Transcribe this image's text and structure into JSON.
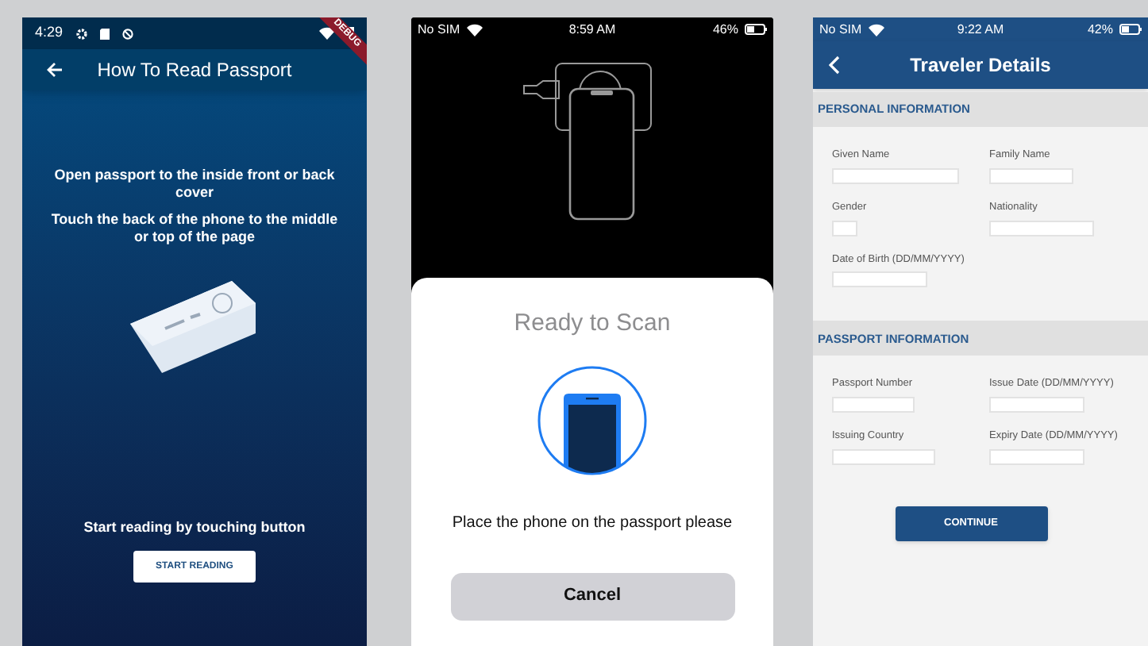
{
  "screens": [
    {
      "kind": "instructions",
      "status_bar": {
        "time": "4:29"
      },
      "debug_banner": "DEBUG",
      "title": "How To Read Passport",
      "paragraphs": [
        "Open passport to the inside front or back cover",
        "Touch the back of the phone to the middle or top of the page"
      ],
      "prompt": "Start reading by touching button",
      "button": "START READING"
    },
    {
      "kind": "scan",
      "status_bar": {
        "carrier": "No SIM",
        "time": "8:59 AM",
        "battery": "46%"
      },
      "sheet_title": "Ready to Scan",
      "message": "Place the phone on the passport please",
      "button": "Cancel"
    },
    {
      "kind": "form",
      "status_bar": {
        "carrier": "No SIM",
        "time": "9:22 AM",
        "battery": "42%"
      },
      "title": "Traveler Details",
      "sections": [
        {
          "title": "PERSONAL INFORMATION",
          "fields": [
            "Given Name",
            "Family Name",
            "Gender",
            "Nationality",
            "Date of Birth (DD/MM/YYYY)"
          ]
        },
        {
          "title": "PASSPORT INFORMATION",
          "fields": [
            "Passport Number",
            "Issue Date (DD/MM/YYYY)",
            "Issuing Country",
            "Expiry Date (DD/MM/YYYY)"
          ]
        }
      ],
      "button": "CONTINUE"
    }
  ]
}
